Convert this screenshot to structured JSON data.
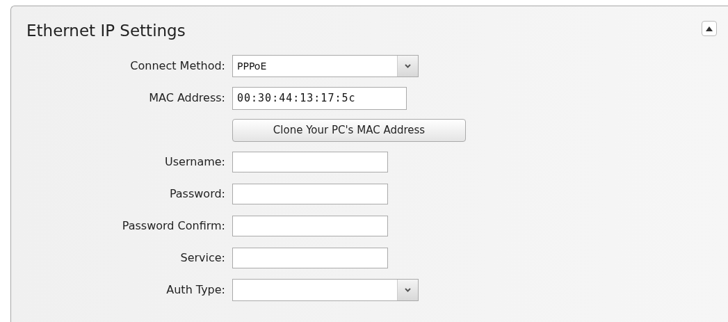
{
  "panel": {
    "title": "Ethernet IP Settings",
    "collapsed": false
  },
  "fields": [
    {
      "kind": "select",
      "label": "Connect Method:",
      "value": "PPPoE"
    },
    {
      "kind": "text",
      "label": "MAC Address:",
      "value": "00:30:44:13:17:5c"
    },
    {
      "kind": "button",
      "label": "Clone Your PC's MAC Address"
    },
    {
      "kind": "text",
      "label": "Username:"
    },
    {
      "kind": "text",
      "label": "Password:"
    },
    {
      "kind": "text",
      "label": "Password Confirm:"
    },
    {
      "kind": "text",
      "label": "Service:"
    },
    {
      "kind": "select",
      "label": "Auth Type:"
    }
  ]
}
